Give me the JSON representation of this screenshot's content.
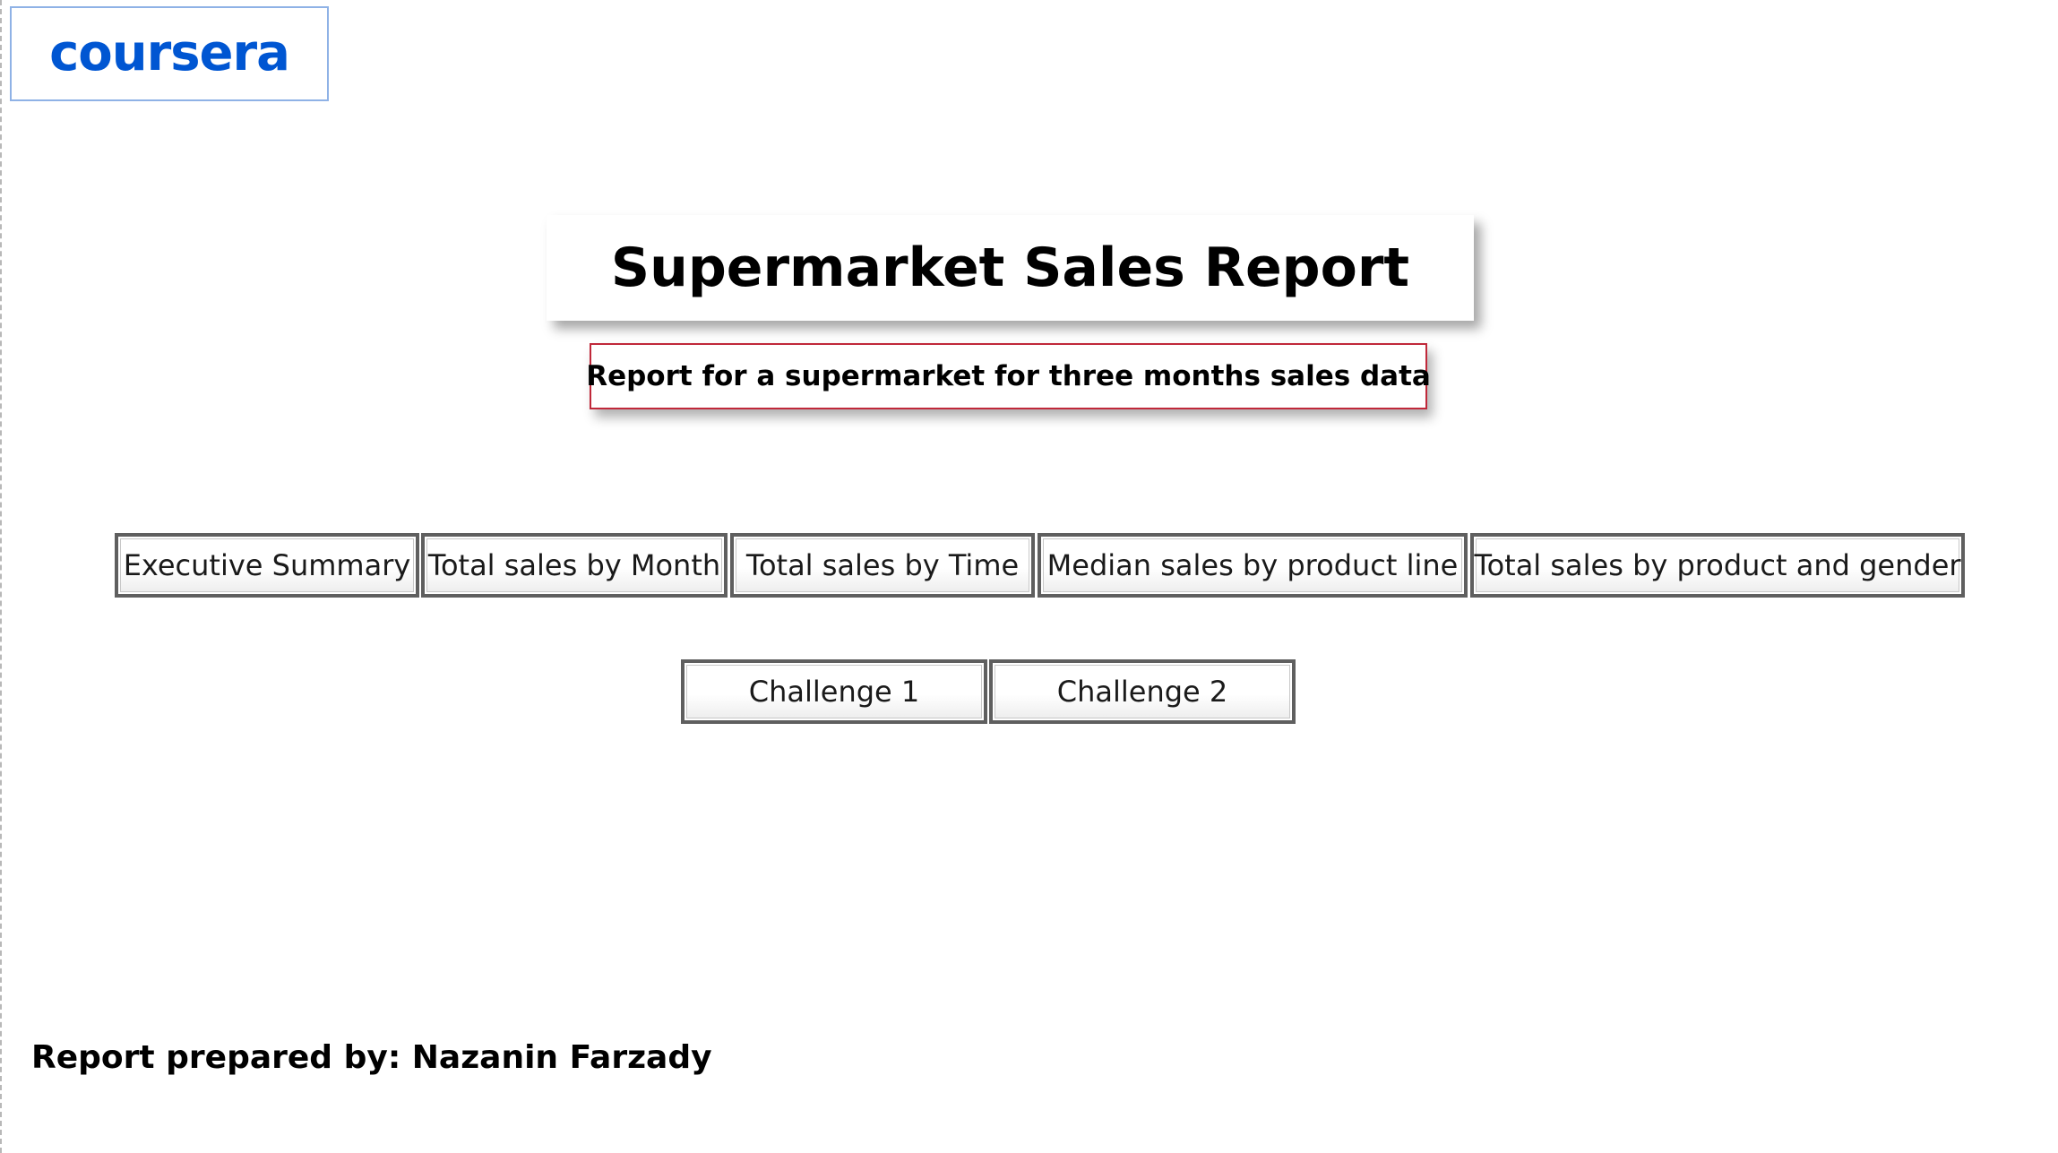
{
  "logo": {
    "text": "coursera",
    "color": "#0056d2"
  },
  "report": {
    "title": "Supermarket Sales Report",
    "subtitle": "Report for a supermarket for three months sales data"
  },
  "nav_row_1": [
    "Executive Summary",
    "Total sales by Month",
    "Total sales by Time",
    "Median sales by product line",
    "Total sales by product and gender"
  ],
  "nav_row_2": [
    "Challenge 1",
    "Challenge 2"
  ],
  "footer": {
    "prepared_by": "Report prepared by: Nazanin Farzady"
  },
  "colors": {
    "subtitle_border": "#c0283a",
    "button_border": "#5f5f5f"
  }
}
